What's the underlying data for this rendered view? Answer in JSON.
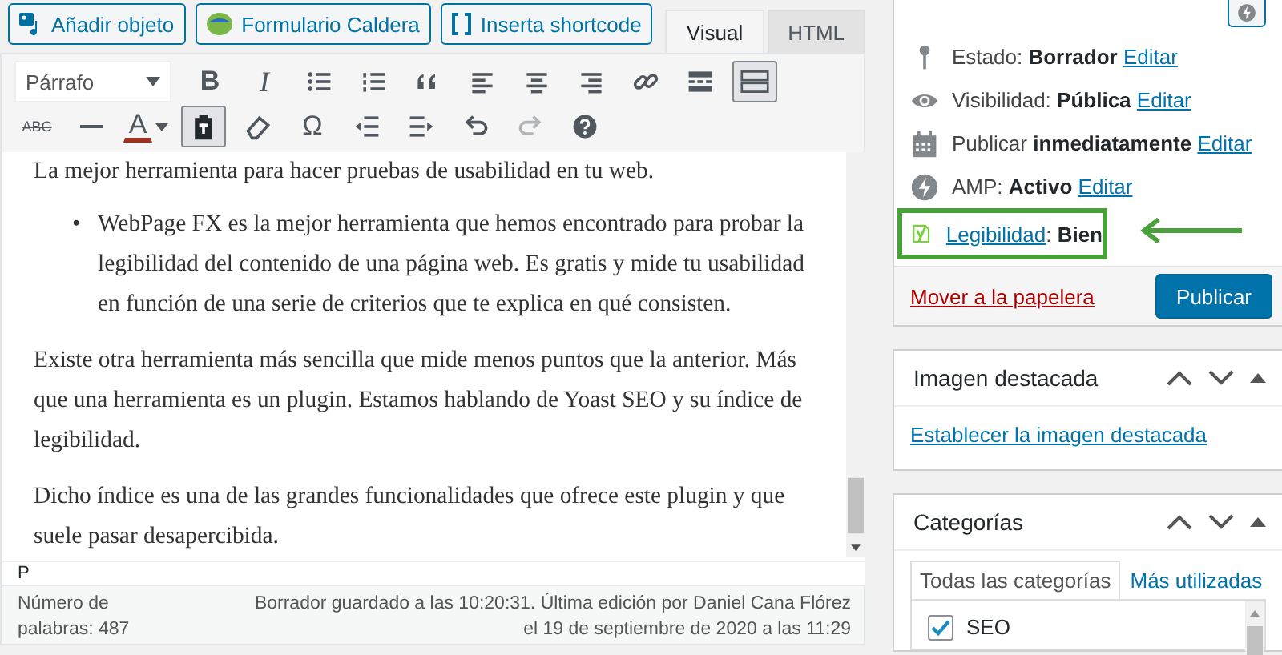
{
  "media_buttons": [
    {
      "kind": "media",
      "label": "Añadir objeto"
    },
    {
      "kind": "caldera",
      "label": "Formulario Caldera"
    },
    {
      "kind": "shortcode",
      "label": "Inserta shortcode"
    }
  ],
  "editor_tabs": [
    {
      "label": "Visual",
      "selected": true
    },
    {
      "label": "HTML",
      "selected": false
    }
  ],
  "toolbar": {
    "format_select": "Párrafo",
    "row_1": [
      {
        "kind": "text",
        "label": "B",
        "pressed": false,
        "disabled": false
      },
      {
        "kind": "text",
        "label": "I",
        "pressed": false,
        "disabled": false
      },
      {
        "kind": "icon",
        "pressed": false,
        "disabled": false
      },
      {
        "kind": "icon",
        "pressed": false,
        "disabled": false
      },
      {
        "kind": "icon",
        "pressed": false,
        "disabled": false
      },
      {
        "kind": "icon",
        "pressed": false,
        "disabled": false
      },
      {
        "kind": "icon",
        "pressed": false,
        "disabled": false
      },
      {
        "kind": "icon",
        "pressed": false,
        "disabled": false
      },
      {
        "kind": "icon",
        "pressed": false,
        "disabled": false
      },
      {
        "kind": "icon",
        "pressed": false,
        "disabled": false
      },
      {
        "kind": "icon",
        "pressed": true,
        "disabled": false
      }
    ],
    "row_2": [
      {
        "kind": "text",
        "label": "ABC",
        "pressed": false,
        "disabled": false
      },
      {
        "kind": "icon",
        "pressed": false,
        "disabled": false
      },
      {
        "kind": "color",
        "label": "A",
        "pressed": false,
        "disabled": false
      },
      {
        "kind": "icon",
        "pressed": true,
        "disabled": false
      },
      {
        "kind": "icon",
        "pressed": false,
        "disabled": false
      },
      {
        "kind": "text",
        "label": "Ω",
        "pressed": false,
        "disabled": false
      },
      {
        "kind": "icon",
        "pressed": false,
        "disabled": false
      },
      {
        "kind": "icon",
        "pressed": false,
        "disabled": false
      },
      {
        "kind": "icon",
        "pressed": false,
        "disabled": false
      },
      {
        "kind": "icon",
        "pressed": false,
        "disabled": true
      },
      {
        "kind": "icon",
        "pressed": false,
        "disabled": false
      }
    ]
  },
  "content": [
    {
      "kind": "paragraph",
      "text": "La mejor herramienta para hacer pruebas de usabilidad en tu web."
    },
    {
      "kind": "bullet",
      "marker": "•",
      "text": "WebPage FX es la mejor herramienta que hemos encontrado para probar la legibilidad del contenido de una página web. Es gratis y mide tu usabilidad en función de una serie de criterios que te explica en qué consisten."
    },
    {
      "kind": "paragraph",
      "text": "Existe otra herramienta más sencilla que mide menos puntos que la anterior. Más que una herramienta es un plugin. Estamos hablando de Yoast SEO y su índice de legibilidad."
    },
    {
      "kind": "paragraph",
      "text": "Dicho índice es una de las grandes funcionalidades que ofrece este plugin y que suele pasar desapercibida."
    }
  ],
  "path": "P",
  "status_bar": {
    "word_count": "Número de palabras: 487",
    "save_info": "Borrador guardado a las 10:20:31. Última edición por Daniel Cana Flórez el 19 de septiembre de 2020 a las 11:29"
  },
  "publish": {
    "rows": [
      {
        "kind": "status",
        "label": "Estado:",
        "value": "Borrador",
        "link": "Editar",
        "highlighted": false
      },
      {
        "kind": "status",
        "label": "Visibilidad:",
        "value": "Pública",
        "link": "Editar",
        "highlighted": false
      },
      {
        "kind": "status",
        "label": "Publicar",
        "value": "inmediatamente",
        "link": "Editar",
        "highlighted": false
      },
      {
        "kind": "status",
        "label": "AMP:",
        "value": "Activo",
        "link": "Editar",
        "highlighted": false
      },
      {
        "kind": "readability",
        "link": "Legibilidad",
        "separator": ":",
        "value": "Bien",
        "highlighted": true
      }
    ],
    "trash_link": "Mover a la papelera",
    "publish_button": "Publicar"
  },
  "featured_image": {
    "title": "Imagen destacada",
    "link": "Establecer la imagen destacada"
  },
  "categories": {
    "title": "Categorías",
    "tabs": [
      {
        "label": "Todas las categorías",
        "selected": true
      },
      {
        "label": "Más utilizadas",
        "selected": false
      }
    ],
    "items": [
      {
        "label": "SEO",
        "checked": true
      }
    ]
  }
}
